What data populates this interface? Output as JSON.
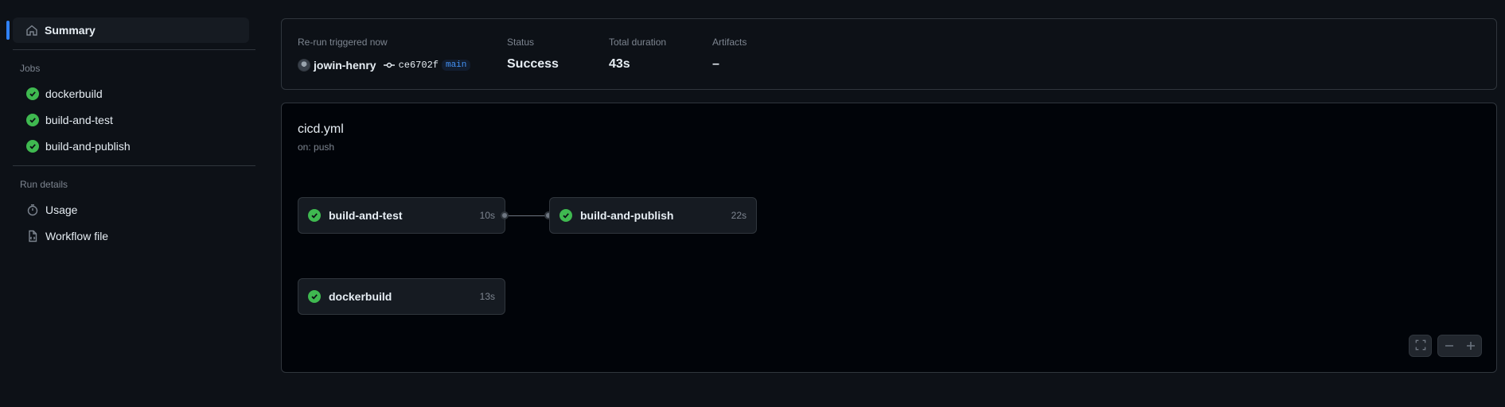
{
  "sidebar": {
    "summary_label": "Summary",
    "jobs_heading": "Jobs",
    "jobs": [
      {
        "label": "dockerbuild",
        "status": "success"
      },
      {
        "label": "build-and-test",
        "status": "success"
      },
      {
        "label": "build-and-publish",
        "status": "success"
      }
    ],
    "run_details_heading": "Run details",
    "usage_label": "Usage",
    "workflow_file_label": "Workflow file"
  },
  "summary": {
    "trigger_label": "Re-run triggered now",
    "actor": "jowin-henry",
    "commit_sha": "ce6702f",
    "branch": "main",
    "status_label": "Status",
    "status_value": "Success",
    "duration_label": "Total duration",
    "duration_value": "43s",
    "artifacts_label": "Artifacts",
    "artifacts_value": "–"
  },
  "workflow": {
    "file": "cicd.yml",
    "trigger": "on: push",
    "nodes": [
      {
        "name": "build-and-test",
        "duration": "10s"
      },
      {
        "name": "build-and-publish",
        "duration": "22s"
      },
      {
        "name": "dockerbuild",
        "duration": "13s"
      }
    ]
  },
  "colors": {
    "success": "#3fb950",
    "accent": "#2f81f7",
    "background": "#0d1117"
  },
  "icons": {
    "summary": "home-icon",
    "usage": "stopwatch-icon",
    "workflow_file": "file-code-icon",
    "job_status": "check-circle-fill-icon",
    "fullscreen": "screen-full-icon",
    "zoom_out": "dash-icon",
    "zoom_in": "plus-icon"
  }
}
